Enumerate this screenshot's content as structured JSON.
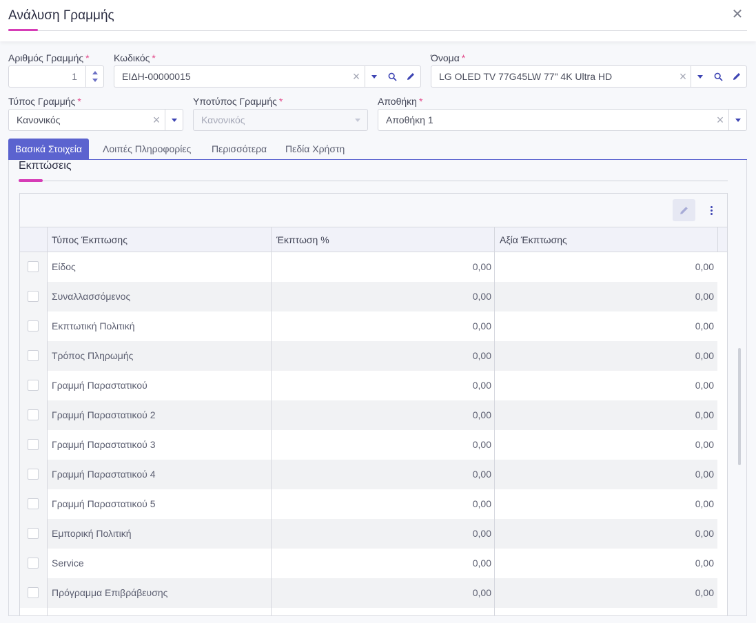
{
  "dialog": {
    "title": "Ανάλυση Γραμμής",
    "close_glyph": "✕"
  },
  "fields": {
    "line_number": {
      "label": "Αριθμός Γραμμής",
      "value": "1"
    },
    "code": {
      "label": "Κωδικός",
      "value": "ΕΙΔΗ-00000015"
    },
    "name": {
      "label": "Όνομα",
      "value": "LG OLED TV 77G45LW 77\" 4K Ultra HD"
    },
    "line_type": {
      "label": "Τύπος Γραμμής",
      "value": "Κανονικός"
    },
    "line_subtype": {
      "label": "Υποτύπος Γραμμής",
      "value": "Κανονικός"
    },
    "warehouse": {
      "label": "Αποθήκη",
      "value": "Αποθήκη 1"
    },
    "required_mark": "*"
  },
  "tabs": [
    {
      "label": "Βασικά Στοιχεία",
      "active": true
    },
    {
      "label": "Λοιπές Πληροφορίες",
      "active": false
    },
    {
      "label": "Περισσότερα",
      "active": false
    },
    {
      "label": "Πεδία Χρήστη",
      "active": false
    }
  ],
  "section": {
    "title": "Εκπτώσεις"
  },
  "grid": {
    "columns": [
      "Τύπος Έκπτωσης",
      "Έκπτωση %",
      "Αξία Έκπτωσης"
    ],
    "rows": [
      {
        "type": "Είδος",
        "percent": "0,00",
        "amount": "0,00"
      },
      {
        "type": "Συναλλασσόμενος",
        "percent": "0,00",
        "amount": "0,00"
      },
      {
        "type": "Εκπτωτική Πολιτική",
        "percent": "0,00",
        "amount": "0,00"
      },
      {
        "type": "Τρόπος Πληρωμής",
        "percent": "0,00",
        "amount": "0,00"
      },
      {
        "type": "Γραμμή Παραστατικού",
        "percent": "0,00",
        "amount": "0,00"
      },
      {
        "type": "Γραμμή Παραστατικού 2",
        "percent": "0,00",
        "amount": "0,00"
      },
      {
        "type": "Γραμμή Παραστατικού 3",
        "percent": "0,00",
        "amount": "0,00"
      },
      {
        "type": "Γραμμή Παραστατικού 4",
        "percent": "0,00",
        "amount": "0,00"
      },
      {
        "type": "Γραμμή Παραστατικού 5",
        "percent": "0,00",
        "amount": "0,00"
      },
      {
        "type": "Εμπορική Πολιτική",
        "percent": "0,00",
        "amount": "0,00"
      },
      {
        "type": "Service",
        "percent": "0,00",
        "amount": "0,00"
      },
      {
        "type": "Πρόγραμμα Επιβράβευσης",
        "percent": "0,00",
        "amount": "0,00"
      }
    ]
  },
  "colors": {
    "accent": "#5b63cf",
    "brand_pink": "#d63cb6",
    "required": "#e24a8a"
  },
  "icons": [
    "close-icon",
    "clear-icon",
    "dropdown-caret-icon",
    "search-icon",
    "pencil-icon",
    "more-vertical-icon",
    "spinner-up-icon",
    "spinner-down-icon"
  ]
}
